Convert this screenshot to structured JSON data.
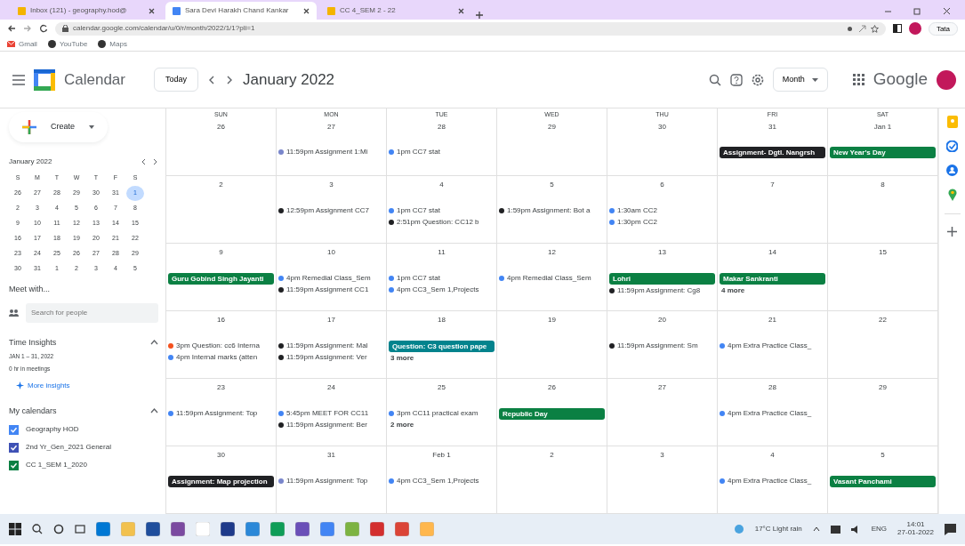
{
  "browser": {
    "tabs": [
      {
        "title": "Inbox (121) - geography.hod@",
        "selected": false
      },
      {
        "title": "Sara Devi Harakh Chand Kankar",
        "selected": true
      },
      {
        "title": "CC 4_SEM 2 - 22",
        "selected": false
      }
    ],
    "url": "calendar.google.com/calendar/u/0/r/month/2022/1/1?pli=1",
    "bookmarks": [
      "Gmail",
      "YouTube",
      "Maps"
    ],
    "profile_button": "Tata"
  },
  "header": {
    "app_name": "Calendar",
    "today_button": "Today",
    "period": "January 2022",
    "view_button": "Month",
    "brand": "Google"
  },
  "sidebar": {
    "create_button": "Create",
    "mini_calendar": {
      "title": "January 2022",
      "weekdays": [
        "S",
        "M",
        "T",
        "W",
        "T",
        "F",
        "S"
      ],
      "days": [
        {
          "day": "26",
          "selected": false
        },
        {
          "day": "27",
          "selected": false
        },
        {
          "day": "28",
          "selected": false
        },
        {
          "day": "29",
          "selected": false
        },
        {
          "day": "30",
          "selected": false
        },
        {
          "day": "31",
          "selected": false
        },
        {
          "day": "1",
          "selected": true
        },
        {
          "day": "2",
          "selected": false
        },
        {
          "day": "3",
          "selected": false
        },
        {
          "day": "4",
          "selected": false
        },
        {
          "day": "5",
          "selected": false
        },
        {
          "day": "6",
          "selected": false
        },
        {
          "day": "7",
          "selected": false
        },
        {
          "day": "8",
          "selected": false
        },
        {
          "day": "9",
          "selected": false
        },
        {
          "day": "10",
          "selected": false
        },
        {
          "day": "11",
          "selected": false
        },
        {
          "day": "12",
          "selected": false
        },
        {
          "day": "13",
          "selected": false
        },
        {
          "day": "14",
          "selected": false
        },
        {
          "day": "15",
          "selected": false
        },
        {
          "day": "16",
          "selected": false
        },
        {
          "day": "17",
          "selected": false
        },
        {
          "day": "18",
          "selected": false
        },
        {
          "day": "19",
          "selected": false
        },
        {
          "day": "20",
          "selected": false
        },
        {
          "day": "21",
          "selected": false
        },
        {
          "day": "22",
          "selected": false
        },
        {
          "day": "23",
          "selected": false
        },
        {
          "day": "24",
          "selected": false
        },
        {
          "day": "25",
          "selected": false
        },
        {
          "day": "26",
          "selected": false
        },
        {
          "day": "27",
          "selected": false
        },
        {
          "day": "28",
          "selected": false
        },
        {
          "day": "29",
          "selected": false
        },
        {
          "day": "30",
          "selected": false
        },
        {
          "day": "31",
          "selected": false
        },
        {
          "day": "1",
          "selected": false
        },
        {
          "day": "2",
          "selected": false
        },
        {
          "day": "3",
          "selected": false
        },
        {
          "day": "4",
          "selected": false
        },
        {
          "day": "5",
          "selected": false
        }
      ]
    },
    "meet_title": "Meet with...",
    "people_search": {
      "placeholder": "Search for people"
    },
    "insights": {
      "title": "Time Insights",
      "expanded": true,
      "range": "JAN 1 – 31, 2022",
      "summary": "0 hr in meetings",
      "link": "More insights"
    },
    "my_calendars": {
      "title": "My calendars",
      "expanded": true,
      "items": [
        {
          "name": "Geography HOD",
          "checked": true,
          "color": "#4285f4"
        },
        {
          "name": "2nd Yr_Gen_2021 General",
          "checked": true,
          "color": "#3f51b5"
        },
        {
          "name": "CC 1_SEM 1_2020",
          "checked": true,
          "color": "#0b8043"
        }
      ]
    }
  },
  "weekdays": [
    "SUN",
    "MON",
    "TUE",
    "WED",
    "THU",
    "FRI",
    "SAT"
  ],
  "weeks": [
    [
      {
        "date": "26"
      },
      {
        "date": "27",
        "events": [
          {
            "kind": "timed",
            "time": "11:59pm",
            "title": "Assignment 1:Mi",
            "color": "#7986cb"
          }
        ]
      },
      {
        "date": "28",
        "events": [
          {
            "kind": "timed",
            "time": "1pm",
            "title": "CC7 stat",
            "color": "#4285f4"
          }
        ]
      },
      {
        "date": "29"
      },
      {
        "date": "30"
      },
      {
        "date": "31",
        "events": [
          {
            "kind": "allday",
            "title": "Assignment- Dgtl. Nangrsh",
            "color": "#202124"
          }
        ]
      },
      {
        "date": "Jan 1",
        "events": [
          {
            "kind": "allday",
            "title": "New Year's Day",
            "color": "#0b8043"
          }
        ]
      }
    ],
    [
      {
        "date": "2"
      },
      {
        "date": "3",
        "events": [
          {
            "kind": "timed",
            "time": "12:59pm",
            "title": "Assignment CC7",
            "color": "#202124"
          }
        ]
      },
      {
        "date": "4",
        "events": [
          {
            "kind": "timed",
            "time": "1pm",
            "title": "CC7 stat",
            "color": "#4285f4"
          },
          {
            "kind": "timed",
            "time": "2:51pm",
            "title": "Question: CC12 b",
            "color": "#202124"
          }
        ]
      },
      {
        "date": "5",
        "events": [
          {
            "kind": "timed",
            "time": "1:59pm",
            "title": "Assignment: Bot a",
            "color": "#202124"
          }
        ]
      },
      {
        "date": "6",
        "events": [
          {
            "kind": "timed",
            "time": "1:30am",
            "title": "CC2",
            "color": "#4285f4"
          },
          {
            "kind": "timed",
            "time": "1:30pm",
            "title": "CC2",
            "color": "#4285f4"
          }
        ]
      },
      {
        "date": "7"
      },
      {
        "date": "8"
      }
    ],
    [
      {
        "date": "9",
        "events": [
          {
            "kind": "allday",
            "title": "Guru Gobind Singh Jayanti",
            "color": "#0b8043"
          }
        ]
      },
      {
        "date": "10",
        "events": [
          {
            "kind": "timed",
            "time": "4pm",
            "title": "Remedial Class_Sem",
            "color": "#4285f4"
          },
          {
            "kind": "timed",
            "time": "11:59pm",
            "title": "Assignment CC1",
            "color": "#202124"
          }
        ]
      },
      {
        "date": "11",
        "events": [
          {
            "kind": "timed",
            "time": "1pm",
            "title": "CC7 stat",
            "color": "#4285f4"
          },
          {
            "kind": "timed",
            "time": "4pm",
            "title": "CC3_Sem 1,Projects",
            "color": "#4285f4"
          }
        ]
      },
      {
        "date": "12",
        "events": [
          {
            "kind": "timed",
            "time": "4pm",
            "title": "Remedial Class_Sem",
            "color": "#4285f4"
          }
        ]
      },
      {
        "date": "13",
        "events": [
          {
            "kind": "allday",
            "title": "Lohri",
            "color": "#0b8043"
          },
          {
            "kind": "timed",
            "time": "11:59pm",
            "title": "Assignment: Cg8",
            "color": "#202124"
          }
        ]
      },
      {
        "date": "14",
        "events": [
          {
            "kind": "allday",
            "title": "Makar Sankranti",
            "color": "#0b8043"
          },
          {
            "kind": "more",
            "title": "4 more"
          }
        ]
      },
      {
        "date": "15"
      }
    ],
    [
      {
        "date": "16",
        "events": [
          {
            "kind": "timed",
            "time": "3pm",
            "title": "Question: cc6 Interna",
            "color": "#f4511e"
          },
          {
            "kind": "timed",
            "time": "4pm",
            "title": "Internal marks (atten",
            "color": "#4285f4"
          }
        ]
      },
      {
        "date": "17",
        "events": [
          {
            "kind": "timed",
            "time": "11:59pm",
            "title": "Assignment: Mal",
            "color": "#202124"
          },
          {
            "kind": "timed",
            "time": "11:59pm",
            "title": "Assignment: Ver",
            "color": "#202124"
          }
        ]
      },
      {
        "date": "18",
        "events": [
          {
            "kind": "allday",
            "title": "Question: C3 question pape",
            "color": "#03838d"
          },
          {
            "kind": "more",
            "title": "3 more"
          }
        ]
      },
      {
        "date": "19"
      },
      {
        "date": "20",
        "events": [
          {
            "kind": "timed",
            "time": "11:59pm",
            "title": "Assignment: Sm",
            "color": "#202124"
          }
        ]
      },
      {
        "date": "21",
        "events": [
          {
            "kind": "timed",
            "time": "4pm",
            "title": "Extra Practice Class_",
            "color": "#4285f4"
          }
        ]
      },
      {
        "date": "22"
      }
    ],
    [
      {
        "date": "23",
        "events": [
          {
            "kind": "timed",
            "time": "11:59pm",
            "title": "Assignment: Top",
            "color": "#4285f4"
          }
        ]
      },
      {
        "date": "24",
        "events": [
          {
            "kind": "timed",
            "time": "5:45pm",
            "title": "MEET FOR CC11",
            "color": "#4285f4"
          },
          {
            "kind": "timed",
            "time": "11:59pm",
            "title": "Assignment: Ber",
            "color": "#202124"
          }
        ]
      },
      {
        "date": "25",
        "events": [
          {
            "kind": "timed",
            "time": "3pm",
            "title": "CC11 practical exam",
            "color": "#4285f4"
          },
          {
            "kind": "more",
            "title": "2 more"
          }
        ]
      },
      {
        "date": "26",
        "events": [
          {
            "kind": "allday",
            "title": "Republic Day",
            "color": "#0b8043"
          }
        ]
      },
      {
        "date": "27"
      },
      {
        "date": "28",
        "events": [
          {
            "kind": "timed",
            "time": "4pm",
            "title": "Extra Practice Class_",
            "color": "#4285f4"
          }
        ]
      },
      {
        "date": "29"
      }
    ],
    [
      {
        "date": "30",
        "events": [
          {
            "kind": "allday",
            "title": "Assignment: Map projection",
            "color": "#202124"
          }
        ]
      },
      {
        "date": "31",
        "events": [
          {
            "kind": "timed",
            "time": "11:59pm",
            "title": "Assignment: Top",
            "color": "#7986cb"
          }
        ]
      },
      {
        "date": "Feb 1",
        "events": [
          {
            "kind": "timed",
            "time": "4pm",
            "title": "CC3_Sem 1,Projects",
            "color": "#4285f4"
          }
        ]
      },
      {
        "date": "2"
      },
      {
        "date": "3"
      },
      {
        "date": "4",
        "events": [
          {
            "kind": "timed",
            "time": "4pm",
            "title": "Extra Practice Class_",
            "color": "#4285f4"
          }
        ]
      },
      {
        "date": "5",
        "events": [
          {
            "kind": "allday",
            "title": "Vasant Panchami",
            "color": "#0b8043"
          }
        ]
      }
    ]
  ],
  "taskbar": {
    "weather": "17°C Light rain",
    "language": "ENG",
    "time": "14:01",
    "date": "27-01-2022"
  }
}
